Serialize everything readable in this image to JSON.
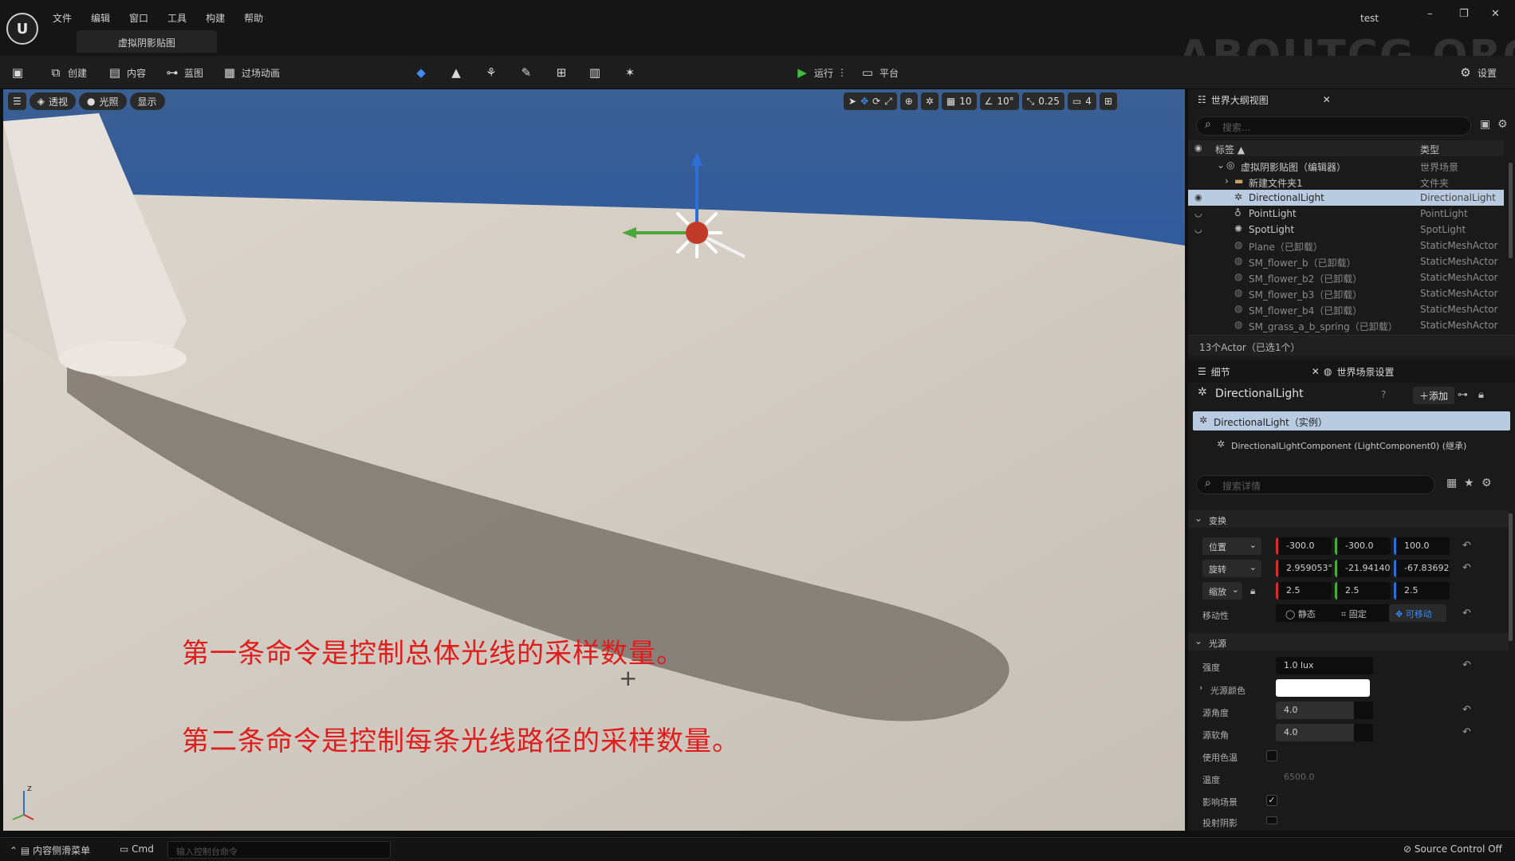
{
  "app": {
    "logo": "U",
    "menu": [
      "文件",
      "编辑",
      "窗口",
      "工具",
      "构建",
      "帮助"
    ],
    "document_tab": "虚拟阴影贴图",
    "project_name": "test",
    "watermark": "ABOUTCG.ORG",
    "window_controls": {
      "minimize": "–",
      "restore": "❐",
      "close": "✕"
    }
  },
  "toolbar": {
    "create": "创建",
    "content": "内容",
    "blueprint": "蓝图",
    "cinematics": "过场动画",
    "play": "运行",
    "platforms": "平台",
    "settings": "设置"
  },
  "viewport": {
    "perspective": "透视",
    "lit": "光照",
    "show": "显示",
    "grid_snap": "10",
    "rotation_snap": "10°",
    "scale_snap": "0.25",
    "camera_speed": "4",
    "subtitle_line1": "第一条命令是控制总体光线的采样数量。",
    "subtitle_line2": "第二条命令是控制每条光线路径的采样数量。",
    "axis_z": "z"
  },
  "outliner": {
    "tab_title": "世界大纲视图",
    "search_placeholder": "搜索...",
    "col_label": "标签 ▲",
    "col_type": "类型",
    "rows": [
      {
        "label": "虚拟阴影贴图（编辑器）",
        "type": "世界场景"
      },
      {
        "label": "新建文件夹1",
        "type": "文件夹"
      },
      {
        "label": "DirectionalLight",
        "type": "DirectionalLight"
      },
      {
        "label": "PointLight",
        "type": "PointLight"
      },
      {
        "label": "SpotLight",
        "type": "SpotLight"
      },
      {
        "label": "Plane（已卸载）",
        "type": "StaticMeshActor"
      },
      {
        "label": "SM_flower_b（已卸载）",
        "type": "StaticMeshActor"
      },
      {
        "label": "SM_flower_b2（已卸载）",
        "type": "StaticMeshActor"
      },
      {
        "label": "SM_flower_b3（已卸载）",
        "type": "StaticMeshActor"
      },
      {
        "label": "SM_flower_b4（已卸载）",
        "type": "StaticMeshActor"
      },
      {
        "label": "SM_grass_a_b_spring（已卸载）",
        "type": "StaticMeshActor"
      }
    ],
    "actor_count": "13个Actor（已选1个）"
  },
  "details": {
    "tab_title": "细节",
    "world_settings_tab": "世界场景设置",
    "object_name": "DirectionalLight",
    "add_button": "添加",
    "instance_row": "DirectionalLight（实例）",
    "component_row": "DirectionalLightComponent (LightComponent0) (继承)",
    "search_placeholder": "搜索详情",
    "transform_section": "变换",
    "location_label": "位置",
    "location": [
      "-300.0",
      "-300.0",
      "100.0"
    ],
    "rotation_label": "旋转",
    "rotation": [
      "2.959053°",
      "-21.94140",
      "-67.83692"
    ],
    "scale_label": "缩放",
    "scale": [
      "2.5",
      "2.5",
      "2.5"
    ],
    "mobility_label": "移动性",
    "mobility_static": "静态",
    "mobility_stationary": "固定",
    "mobility_movable": "可移动",
    "light_section": "光源",
    "intensity_label": "强度",
    "intensity_value": "1.0 lux",
    "light_color_label": "光源颜色",
    "light_color": "#ffffff",
    "source_angle_label": "源角度",
    "source_angle_value": "4.0",
    "source_soft_angle_label": "源软角",
    "source_soft_angle_value": "4.0",
    "use_temperature_label": "使用色温",
    "temperature_label": "温度",
    "temperature_value": "6500.0",
    "affects_world_label": "影响场景",
    "cast_shadows_label": "投射阴影"
  },
  "statusbar": {
    "content_drawer": "内容侧滑菜单",
    "cmd": "Cmd",
    "console_placeholder": "输入控制台命令",
    "source_control": "Source Control Off"
  },
  "colors": {
    "selection": "#b9cbe0",
    "subtitle": "#e01d1d",
    "play_green": "#3fbf3f"
  }
}
